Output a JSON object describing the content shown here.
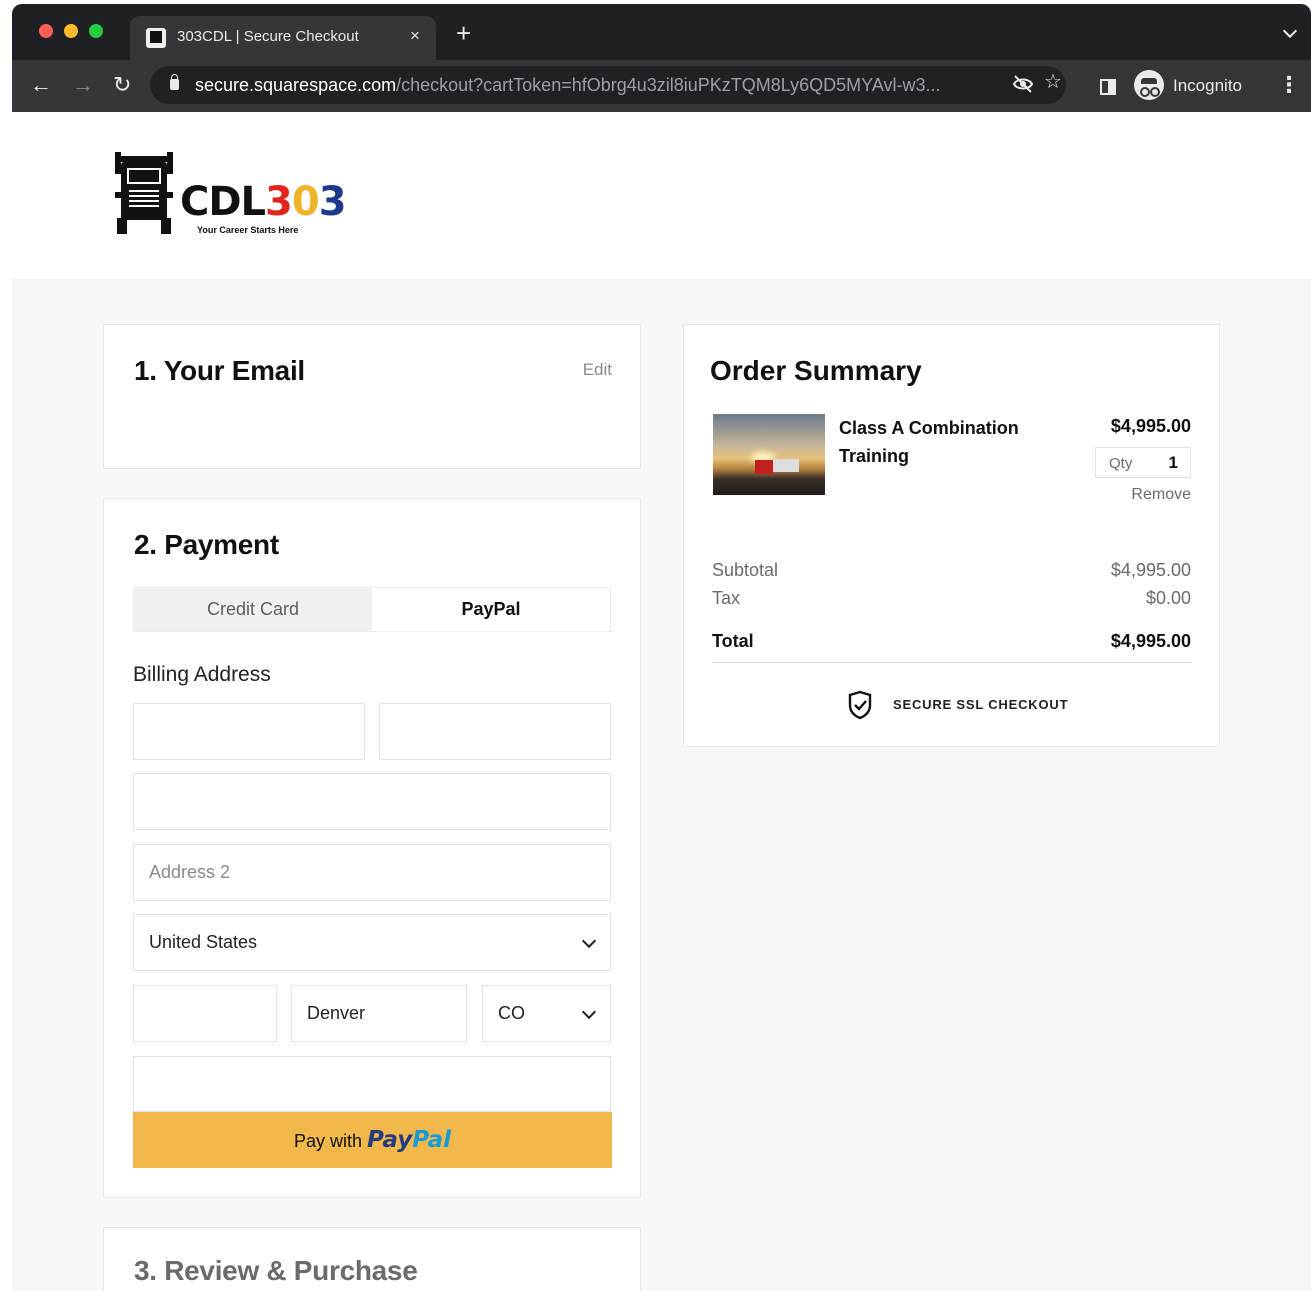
{
  "browser": {
    "tab_title": "303CDL | Secure Checkout",
    "tab_close": "×",
    "new_tab": "+",
    "url_host": "secure.squarespace.com",
    "url_path": "/checkout?cartToken=hfObrg4u3zil8iuPKzTQM8Ly6QD5MYAvl-w3...",
    "profile_label": "Incognito",
    "icons": [
      "back-arrow-icon",
      "forward-arrow-icon",
      "reload-icon",
      "lock-icon",
      "eye-off-icon",
      "star-icon",
      "side-panel-icon",
      "incognito-icon",
      "menu-icon"
    ]
  },
  "logo": {
    "word_parts": [
      "CDL",
      "3",
      "0",
      "3"
    ],
    "tagline": "Your Career Starts Here"
  },
  "email_section": {
    "heading": "1.  Your Email",
    "edit_label": "Edit"
  },
  "payment_section": {
    "heading": "2.  Payment",
    "tabs": [
      {
        "label": "Credit Card",
        "selected": false
      },
      {
        "label": "PayPal",
        "selected": true
      }
    ],
    "billing_label": "Billing Address",
    "fields": {
      "first_name": "",
      "last_name": "",
      "address1": "",
      "address2_placeholder": "Address 2",
      "country": "United States",
      "zip": "",
      "city": "Denver",
      "state": "CO",
      "phone": ""
    },
    "paypal_button": {
      "prefix": "Pay with",
      "brand_pay": "Pay",
      "brand_pal": "Pal"
    }
  },
  "review_section": {
    "heading": "3.  Review & Purchase"
  },
  "order_summary": {
    "heading": "Order Summary",
    "item": {
      "name": "Class A Combination Training",
      "price": "$4,995.00",
      "qty_label": "Qty",
      "qty": "1",
      "remove_label": "Remove"
    },
    "subtotal_label": "Subtotal",
    "subtotal_value": "$4,995.00",
    "tax_label": "Tax",
    "tax_value": "$0.00",
    "total_label": "Total",
    "total_value": "$4,995.00",
    "secure_label": "SECURE SSL CHECKOUT"
  },
  "colors": {
    "paypal_button": "#f2b84b",
    "paypal_blue_dark": "#253b80",
    "paypal_blue_light": "#179bd7",
    "logo_red": "#e1251b",
    "logo_yellow": "#f0b42a",
    "logo_blue": "#1e3a8a"
  }
}
